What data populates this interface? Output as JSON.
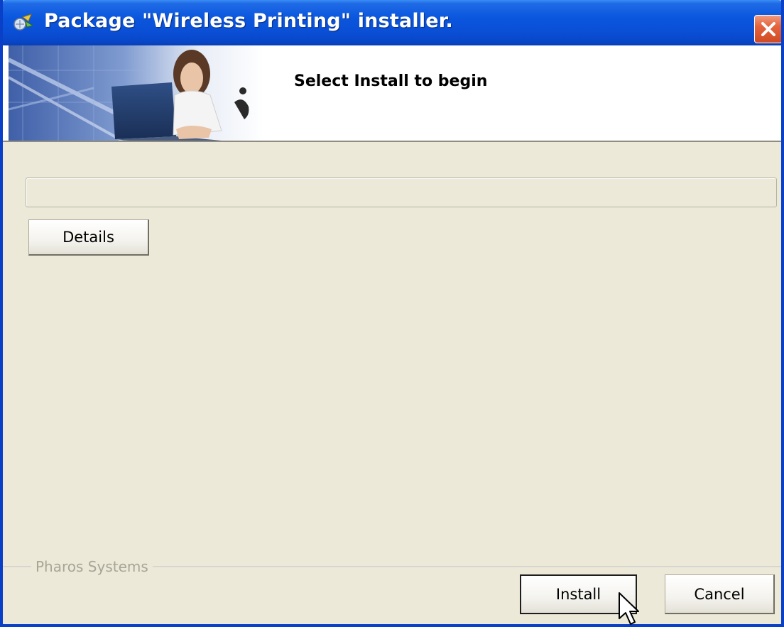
{
  "window": {
    "title": "Package \"Wireless Printing\" installer.",
    "app_icon": "installer-icon",
    "close_icon": "close-icon"
  },
  "banner": {
    "title": "Select Install to begin"
  },
  "progress": {
    "value_percent": 0
  },
  "buttons": {
    "details_label": "Details",
    "install_label": "Install",
    "cancel_label": "Cancel"
  },
  "footer": {
    "brand_label": "Pharos Systems"
  },
  "colors": {
    "titlebar": "#0a56dd",
    "close_button": "#e4633d",
    "dialog_background": "#ece9d8",
    "brand_text": "#a7a597"
  }
}
